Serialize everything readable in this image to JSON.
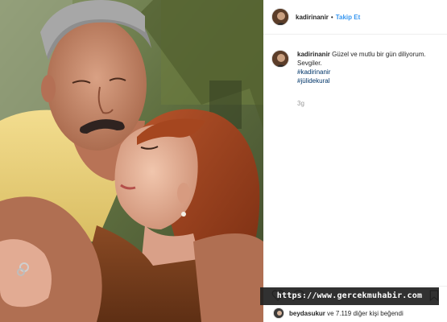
{
  "post": {
    "username": "kadirinanir",
    "dot": "•",
    "follow_label": "Takip Et",
    "photo_alt": "couple-photo"
  },
  "caption": {
    "username": "kadirinanir",
    "text": "Güzel ve mutlu bir gün diliyorum. Sevgiler.",
    "hashtags": [
      "#kadirinanir",
      "#jülidekural"
    ],
    "time": "3g"
  },
  "actions": {
    "icons": [
      "heart-icon",
      "comment-icon",
      "bookmark-icon"
    ]
  },
  "likes": {
    "liker": "beydasukur",
    "rest": "ve 7.119 diğer kişi beğendi"
  },
  "watermark": {
    "text": "https://www.gercekmuhabir.com"
  },
  "colors": {
    "follow": "#3897f0",
    "hashtag": "#003569",
    "muted": "#999999",
    "text": "#262626"
  }
}
